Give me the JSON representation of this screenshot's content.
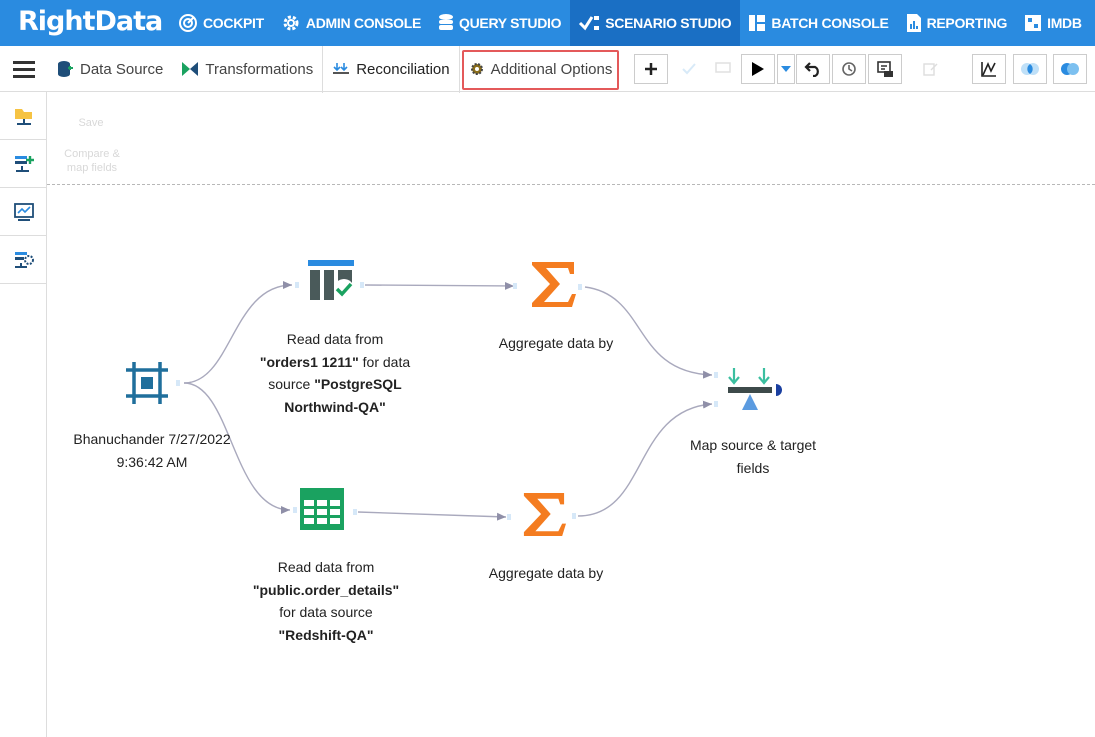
{
  "app": {
    "logo_main": "Right",
    "logo_sub": "Data"
  },
  "nav": [
    {
      "label": "COCKPIT",
      "icon": "cockpit-icon"
    },
    {
      "label": "ADMIN CONSOLE",
      "icon": "gear-icon"
    },
    {
      "label": "QUERY STUDIO",
      "icon": "database-icon"
    },
    {
      "label": "SCENARIO STUDIO",
      "icon": "scenario-icon",
      "active": true
    },
    {
      "label": "BATCH CONSOLE",
      "icon": "batch-icon"
    },
    {
      "label": "REPORTING",
      "icon": "report-icon"
    },
    {
      "label": "IMDB",
      "icon": "imdb-icon"
    }
  ],
  "tabs": [
    {
      "label": "Data Source"
    },
    {
      "label": "Transformations"
    },
    {
      "label": "Reconciliation",
      "active": true
    },
    {
      "label": "Additional Options",
      "highlighted": true
    }
  ],
  "ghost": {
    "label1": "Save",
    "label2": "Compare &",
    "label3": "map fields"
  },
  "workflow": {
    "start": {
      "line1": "Bhanuchander 7/27/2022",
      "line2": "9:36:42 AM"
    },
    "source1": {
      "line1": "Read data from",
      "name": "\"orders1 1211\"",
      "mid": " for data",
      "line3a": "source ",
      "ds1": "\"PostgreSQL",
      "ds2": "Northwind-QA\""
    },
    "agg1": {
      "label": "Aggregate data by"
    },
    "source2": {
      "line1": "Read data from",
      "name": "\"public.order_details\"",
      "line3": "for data source",
      "ds": "\"Redshift-QA\""
    },
    "agg2": {
      "label": "Aggregate data by"
    },
    "map": {
      "line1": "Map source & target",
      "line2": "fields"
    }
  },
  "colors": {
    "topbar": "#2a8be0",
    "active_nav": "#1a6fc4",
    "sigma": "#f47c20",
    "teal": "#1f6f9c",
    "green": "#1aa260",
    "highlight": "#e4595a"
  }
}
